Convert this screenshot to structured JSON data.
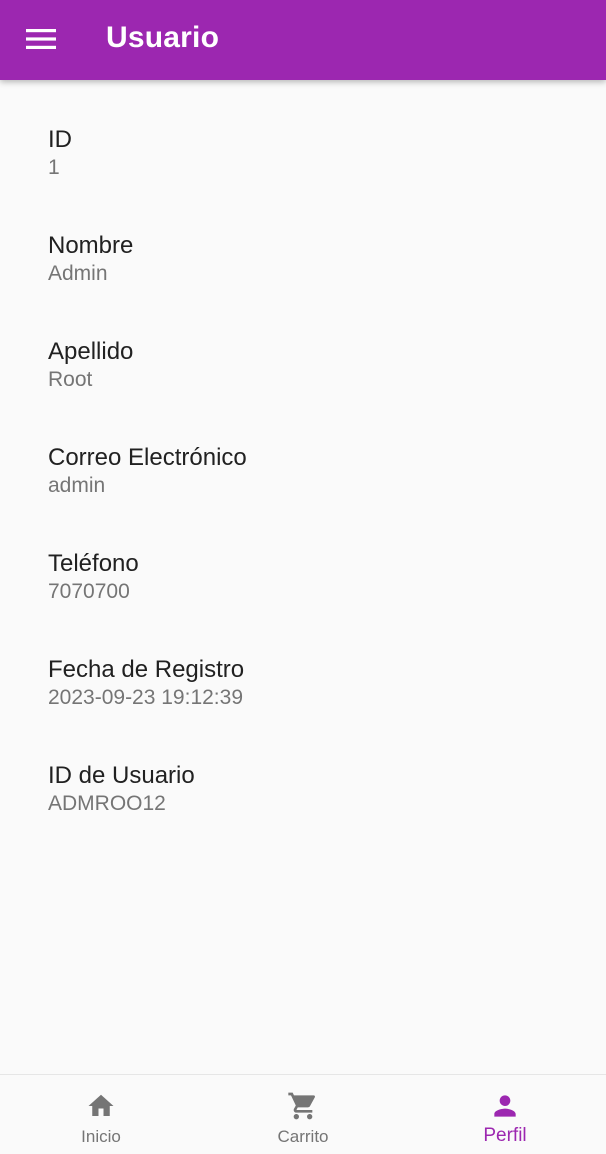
{
  "app_bar": {
    "title": "Usuario",
    "menu_icon": "menu-icon",
    "background_color": "#9c27b0"
  },
  "profile": {
    "fields": [
      {
        "label": "ID",
        "value": "1"
      },
      {
        "label": "Nombre",
        "value": "Admin"
      },
      {
        "label": "Apellido",
        "value": "Root"
      },
      {
        "label": "Correo Electrónico",
        "value": "admin"
      },
      {
        "label": "Teléfono",
        "value": "7070700"
      },
      {
        "label": "Fecha de Registro",
        "value": "2023-09-23 19:12:39"
      },
      {
        "label": "ID de Usuario",
        "value": "ADMROO12"
      }
    ]
  },
  "bottom_nav": {
    "items": [
      {
        "label": "Inicio",
        "icon": "home-icon",
        "active": false
      },
      {
        "label": "Carrito",
        "icon": "cart-icon",
        "active": false
      },
      {
        "label": "Perfil",
        "icon": "person-icon",
        "active": true
      }
    ],
    "active_color": "#9c27b0",
    "inactive_color": "#757575"
  }
}
